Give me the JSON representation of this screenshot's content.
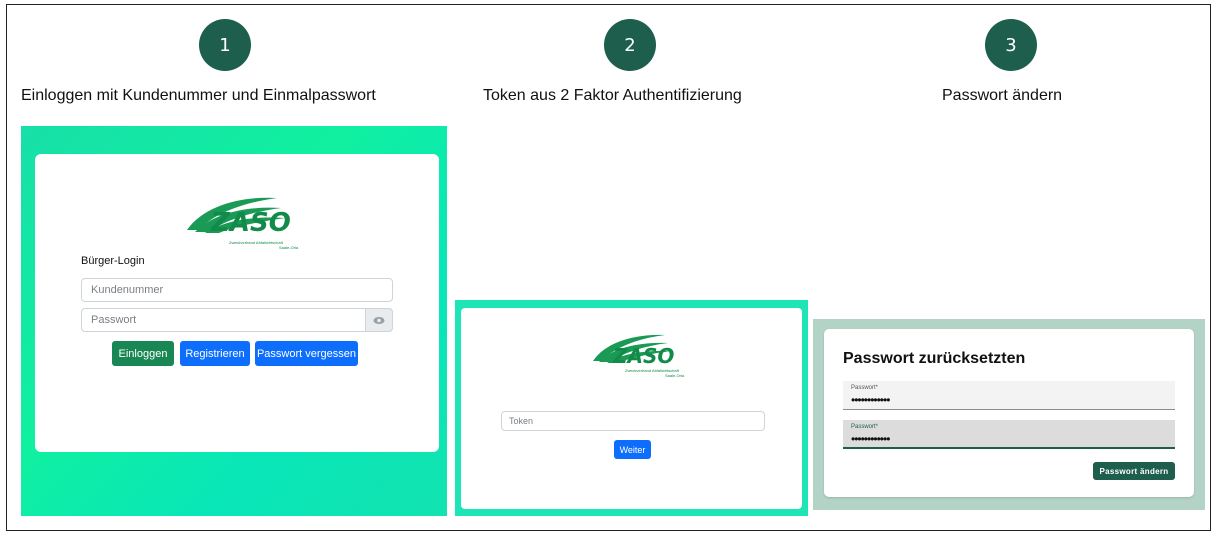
{
  "steps": [
    {
      "number": "1",
      "title": "Einloggen mit Kundenummer und Einmalpasswort"
    },
    {
      "number": "2",
      "title": "Token aus 2 Faktor Authentifizierung"
    },
    {
      "number": "3",
      "title": "Passwort ändern"
    }
  ],
  "logo": {
    "name": "ZASO",
    "subtitle_line1": "Zweckverband Abfallwirtschaft",
    "subtitle_line2": "Saale-Orla"
  },
  "login": {
    "heading": "Bürger-Login",
    "customer_placeholder": "Kundenummer",
    "password_placeholder": "Passwort",
    "login_button": "Einloggen",
    "register_button": "Registrieren",
    "forgot_button": "Passwort vergessen"
  },
  "token": {
    "placeholder": "Token",
    "next_button": "Weiter"
  },
  "reset": {
    "title": "Passwort zurücksetzten",
    "field1_label": "Passwort*",
    "field1_value": "••••••••••••",
    "field2_label": "Passwort*",
    "field2_value": "••••••••••••",
    "submit_button": "Passwort ändern"
  },
  "colors": {
    "step_circle": "#1e5e4c",
    "panel_bg": "#17dfa8",
    "primary_blue": "#0d6efd",
    "success_green": "#198754",
    "logo_green": "#128a4a"
  }
}
